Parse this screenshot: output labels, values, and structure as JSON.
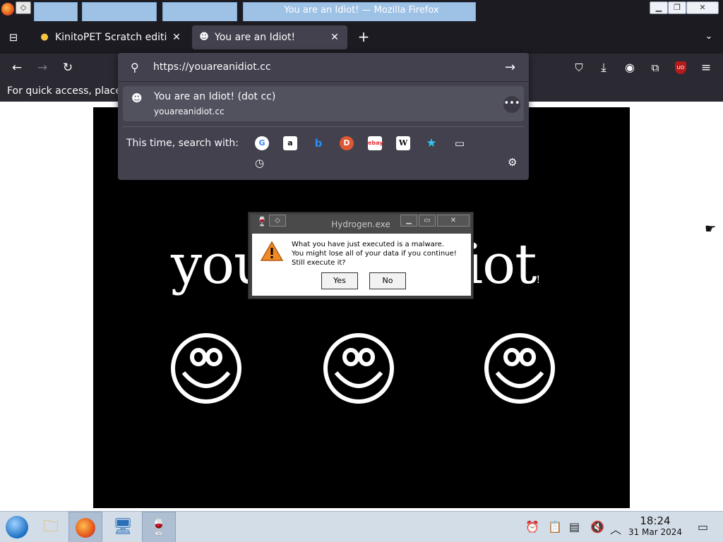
{
  "window": {
    "title": "You are an Idiot! — Mozilla Firefox",
    "controls": [
      "minimize",
      "maximize",
      "close"
    ]
  },
  "tabs": [
    {
      "label": "KinitoPET Scratch edition",
      "icon": "scratch-icon",
      "active": false
    },
    {
      "label": "You are an Idiot!",
      "icon": "smiley-icon",
      "active": true
    }
  ],
  "navbar": {
    "icons": [
      "back-icon",
      "forward-icon",
      "reload-icon",
      "pocket-icon",
      "downloads-icon",
      "account-icon",
      "extensions-icon",
      "ublock-icon",
      "menu-icon"
    ]
  },
  "bookmarks_hint": "For quick access, place",
  "urlbar": {
    "value": "https://youareanidiot.cc",
    "suggestion": {
      "title": "You are an Idiot! (dot cc)",
      "url": "youareanidiot.cc"
    },
    "search_with_label": "This time, search with:",
    "engines": [
      "Google",
      "Amazon",
      "Bing",
      "DuckDuckGo",
      "eBay",
      "Wikipedia",
      "Bookmarks",
      "Tabs",
      "History"
    ]
  },
  "page": {
    "big_text_left": "you",
    "big_text_right": "diot",
    "big_text_tail": "!"
  },
  "dialog": {
    "title": "Hydrogen.exe",
    "lines": [
      "What you have just executed is a malware.",
      "You might lose all of your data if you continue!",
      "Still execute it?"
    ],
    "yes": "Yes",
    "no": "No"
  },
  "taskbar": {
    "time": "18:24",
    "date": "31 Mar 2024"
  },
  "colors": {
    "chrome_dark": "#1c1b22",
    "toolbar": "#2b2a33",
    "panel": "#42414d",
    "taskbar": "#d3dde8"
  }
}
